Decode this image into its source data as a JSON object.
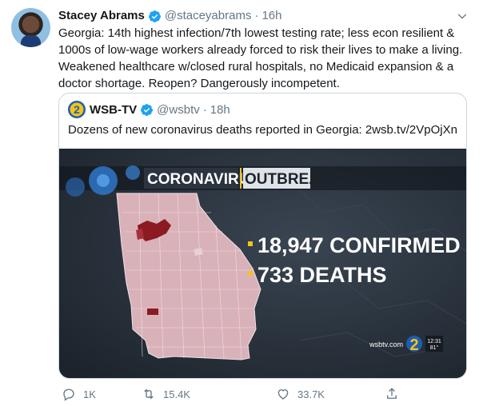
{
  "tweet": {
    "author_name": "Stacey Abrams",
    "author_handle": "@staceyabrams",
    "separator": "·",
    "time": "16h",
    "text": "Georgia: 14th highest infection/7th lowest testing rate; less econ resilient & 1000s of low-wage workers already forced to risk their lives to make a living. Weakened healthcare w/closed rural hospitals, no Medicaid expansion & a doctor shortage. Reopen? Dangerously incompetent."
  },
  "quoted": {
    "logo_text": "2",
    "author_name": "WSB-TV",
    "author_handle": "@wsbtv",
    "separator": "·",
    "time": "18h",
    "text": "Dozens of new coronavirus deaths reported in Georgia: 2wsb.tv/2VpOjXn",
    "media": {
      "banner_left": "CORONAVIRUS",
      "banner_right": "OUTBREAK",
      "stat_confirmed": "18,947 CONFIRMED",
      "stat_deaths": "733 DEATHS",
      "watermark": "wsbtv.com",
      "channel_number": "2",
      "clock_time": "12:31",
      "clock_temp": "81°"
    }
  },
  "actions": {
    "reply_count": "1K",
    "retweet_count": "15.4K",
    "like_count": "33.7K"
  },
  "colors": {
    "verified": "#1da1f2",
    "secondary_text": "#657786",
    "border": "#ccd6dd",
    "map_fill": "#d9b1b9",
    "map_hotspot": "#8b1a22",
    "stat_bullet": "#f4c21b",
    "news_blue": "#1f5db3"
  },
  "icons": [
    "verified-icon",
    "chevron-down-icon",
    "reply-icon",
    "retweet-icon",
    "like-icon",
    "share-icon"
  ]
}
